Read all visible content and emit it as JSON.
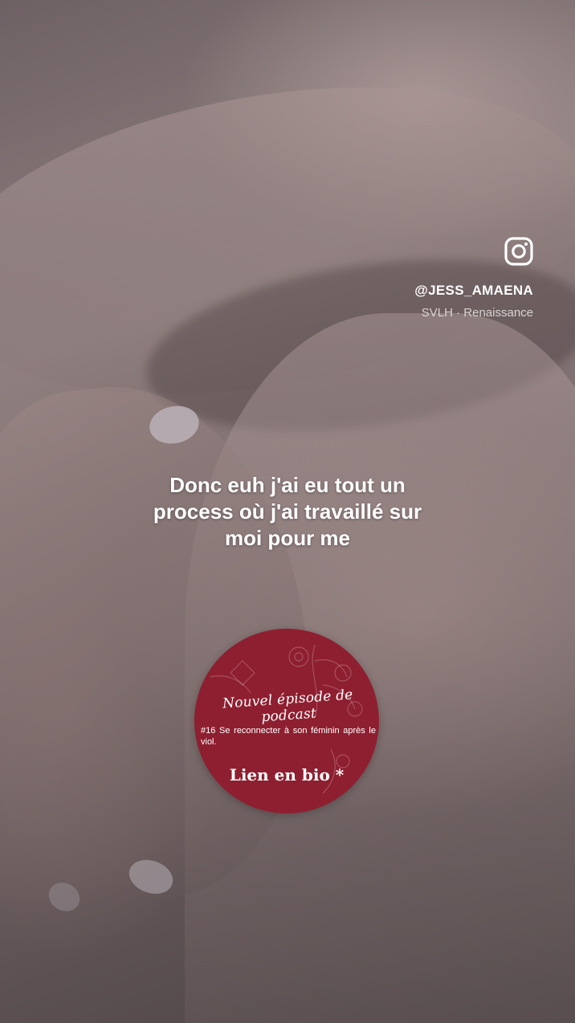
{
  "profile": {
    "icon": "instagram-icon",
    "handle": "@JESS_AMAENA",
    "audio": "SVLH · Renaissance"
  },
  "caption": {
    "line1": "Donc euh j'ai eu tout un",
    "line2": "process où j'ai travaillé sur",
    "line3": "moi pour me"
  },
  "sticker": {
    "title": "Nouvel épisode de podcast",
    "episode": "#16 Se reconnecter à son féminin après le viol.",
    "link": "Lien en bio *",
    "color": "#8e1f30"
  }
}
